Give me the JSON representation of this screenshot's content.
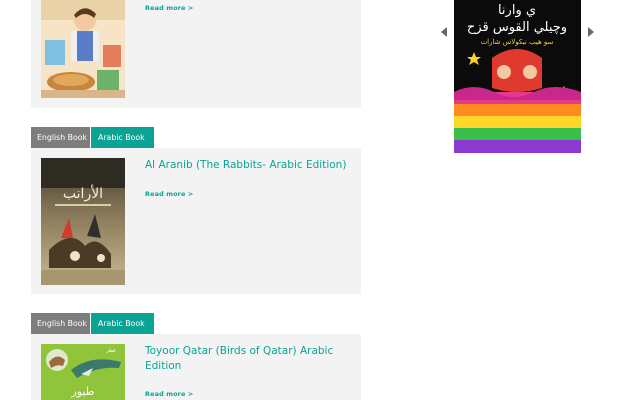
{
  "books": [
    {
      "title": "",
      "read_more": "Read more >"
    },
    {
      "title": "Al Aranib (The Rabbits- Arabic Edition)",
      "read_more": "Read more >"
    },
    {
      "title": "Toyoor Qatar (Birds of Qatar) Arabic Edition",
      "read_more": "Read more >"
    }
  ],
  "tabs": {
    "english": "English Book",
    "arabic": "Arabic Book"
  },
  "carousel": {
    "prev_icon": "left-arrow-icon",
    "next_icon": "right-arrow-icon"
  },
  "colors": {
    "accent": "#0aa394",
    "tab_gray": "#7d7d7d",
    "card_bg": "#f3f3f3"
  }
}
